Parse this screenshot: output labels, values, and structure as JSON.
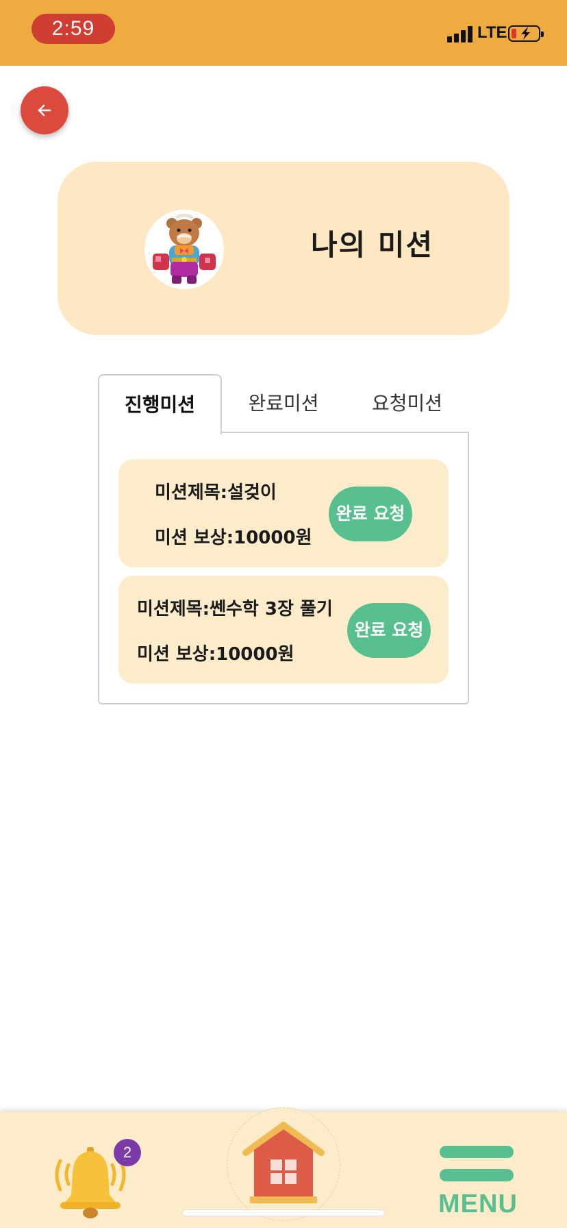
{
  "status_bar": {
    "time": "2:59",
    "network": "LTE",
    "icons": [
      "signal-icon",
      "battery-charging-icon"
    ]
  },
  "header": {
    "back_icon": "arrow-left-icon",
    "title": "나의 미션",
    "avatar": "bear-character-avatar"
  },
  "tabs": [
    {
      "label": "진행미션",
      "active": true
    },
    {
      "label": "완료미션",
      "active": false
    },
    {
      "label": "요청미션",
      "active": false
    }
  ],
  "missions": [
    {
      "title": "미션제목:설겆이",
      "reward": "미션 보상:10000원",
      "button": "완료 요청"
    },
    {
      "title": "미션제목:쎈수학 3장 풀기",
      "reward": "미션 보상:10000원",
      "button": "완료 요청"
    }
  ],
  "bottom_nav": {
    "notification_count": "2",
    "bell_icon": "bell-icon",
    "home_icon": "home-icon",
    "menu_label": "MENU"
  },
  "colors": {
    "status_bar": "#eeab3f",
    "back_button": "#dc4a3d",
    "card_bg": "#fde8c3",
    "accent_green": "#58c090",
    "badge": "#7b3aa8"
  }
}
